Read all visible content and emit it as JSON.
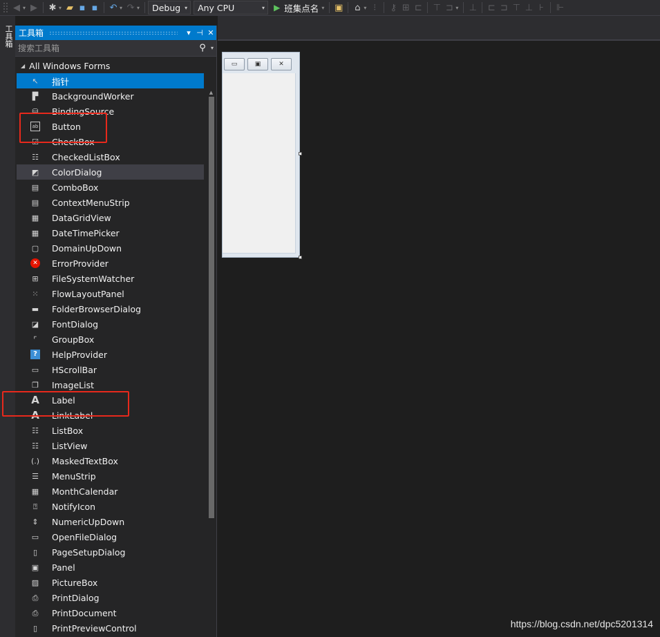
{
  "toolbar": {
    "config_label": "Debug",
    "platform_label": "Any CPU",
    "run_label": "班集点名"
  },
  "side_tab": {
    "label": "工具箱"
  },
  "toolbox": {
    "title": "工具箱",
    "search_placeholder": "搜索工具箱",
    "group_label": "All Windows Forms",
    "items": [
      {
        "label": "指针",
        "icon": "pointer-icon",
        "glyph": "↖"
      },
      {
        "label": "BackgroundWorker",
        "icon": "background-worker-icon",
        "glyph": "▛"
      },
      {
        "label": "BindingSource",
        "icon": "binding-source-icon",
        "glyph": "⛁"
      },
      {
        "label": "Button",
        "icon": "button-icon",
        "glyph": "ab"
      },
      {
        "label": "CheckBox",
        "icon": "checkbox-icon",
        "glyph": "☑"
      },
      {
        "label": "CheckedListBox",
        "icon": "checked-list-box-icon",
        "glyph": "☷"
      },
      {
        "label": "ColorDialog",
        "icon": "color-dialog-icon",
        "glyph": "◩"
      },
      {
        "label": "ComboBox",
        "icon": "combobox-icon",
        "glyph": "▤"
      },
      {
        "label": "ContextMenuStrip",
        "icon": "context-menu-strip-icon",
        "glyph": "▤"
      },
      {
        "label": "DataGridView",
        "icon": "data-grid-view-icon",
        "glyph": "▦"
      },
      {
        "label": "DateTimePicker",
        "icon": "date-time-picker-icon",
        "glyph": "▦"
      },
      {
        "label": "DomainUpDown",
        "icon": "domain-up-down-icon",
        "glyph": "▢"
      },
      {
        "label": "ErrorProvider",
        "icon": "error-provider-icon",
        "glyph": "✕"
      },
      {
        "label": "FileSystemWatcher",
        "icon": "file-system-watcher-icon",
        "glyph": "⊞"
      },
      {
        "label": "FlowLayoutPanel",
        "icon": "flow-layout-panel-icon",
        "glyph": "⁙"
      },
      {
        "label": "FolderBrowserDialog",
        "icon": "folder-browser-dialog-icon",
        "glyph": "▬"
      },
      {
        "label": "FontDialog",
        "icon": "font-dialog-icon",
        "glyph": "◪"
      },
      {
        "label": "GroupBox",
        "icon": "group-box-icon",
        "glyph": "⌜"
      },
      {
        "label": "HelpProvider",
        "icon": "help-provider-icon",
        "glyph": "?"
      },
      {
        "label": "HScrollBar",
        "icon": "hscrollbar-icon",
        "glyph": "▭"
      },
      {
        "label": "ImageList",
        "icon": "image-list-icon",
        "glyph": "❐"
      },
      {
        "label": "Label",
        "icon": "label-icon",
        "glyph": "A"
      },
      {
        "label": "LinkLabel",
        "icon": "link-label-icon",
        "glyph": "A"
      },
      {
        "label": "ListBox",
        "icon": "list-box-icon",
        "glyph": "☷"
      },
      {
        "label": "ListView",
        "icon": "list-view-icon",
        "glyph": "☷"
      },
      {
        "label": "MaskedTextBox",
        "icon": "masked-text-box-icon",
        "glyph": "(.)"
      },
      {
        "label": "MenuStrip",
        "icon": "menu-strip-icon",
        "glyph": "☰"
      },
      {
        "label": "MonthCalendar",
        "icon": "month-calendar-icon",
        "glyph": "▦"
      },
      {
        "label": "NotifyIcon",
        "icon": "notify-icon-icon",
        "glyph": "⍰"
      },
      {
        "label": "NumericUpDown",
        "icon": "numeric-up-down-icon",
        "glyph": "⇕"
      },
      {
        "label": "OpenFileDialog",
        "icon": "open-file-dialog-icon",
        "glyph": "▭"
      },
      {
        "label": "PageSetupDialog",
        "icon": "page-setup-dialog-icon",
        "glyph": "▯"
      },
      {
        "label": "Panel",
        "icon": "panel-icon",
        "glyph": "▣"
      },
      {
        "label": "PictureBox",
        "icon": "picture-box-icon",
        "glyph": "▨"
      },
      {
        "label": "PrintDialog",
        "icon": "print-dialog-icon",
        "glyph": "⎙"
      },
      {
        "label": "PrintDocument",
        "icon": "print-document-icon",
        "glyph": "⎙"
      },
      {
        "label": "PrintPreviewControl",
        "icon": "print-preview-control-icon",
        "glyph": "▯"
      }
    ]
  },
  "watermark": "https://blog.csdn.net/dpc5201314",
  "colors": {
    "accent": "#007acc",
    "highlight_box": "#e8291c",
    "panel_bg": "#252526",
    "editor_bg": "#1e1e1e"
  }
}
